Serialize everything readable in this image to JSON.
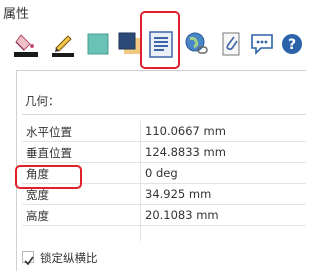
{
  "panel": {
    "title": "属性"
  },
  "toolbar": {
    "icons": [
      {
        "name": "fill-bucket-icon"
      },
      {
        "name": "pen-line-icon"
      },
      {
        "name": "teal-square-icon"
      },
      {
        "name": "shadow-square-icon"
      },
      {
        "name": "document-properties-icon",
        "highlighted": true
      },
      {
        "name": "globe-link-icon"
      },
      {
        "name": "attachment-icon"
      },
      {
        "name": "speech-bubble-icon"
      },
      {
        "name": "help-icon"
      }
    ]
  },
  "geometry": {
    "section_label": "几何：",
    "rows": [
      {
        "key": "水平位置",
        "value": "110.0667 mm"
      },
      {
        "key": "垂直位置",
        "value": "124.8833 mm"
      },
      {
        "key": "角度",
        "value": "0 deg",
        "highlighted": true
      },
      {
        "key": "宽度",
        "value": "34.925 mm"
      },
      {
        "key": "高度",
        "value": "20.1083 mm"
      }
    ]
  },
  "lock_aspect": {
    "label": "锁定纵横比",
    "checked": true
  },
  "colors": {
    "highlight": "#e0202a",
    "accent_teal": "#69c2b7",
    "help_blue": "#2b63a8"
  }
}
